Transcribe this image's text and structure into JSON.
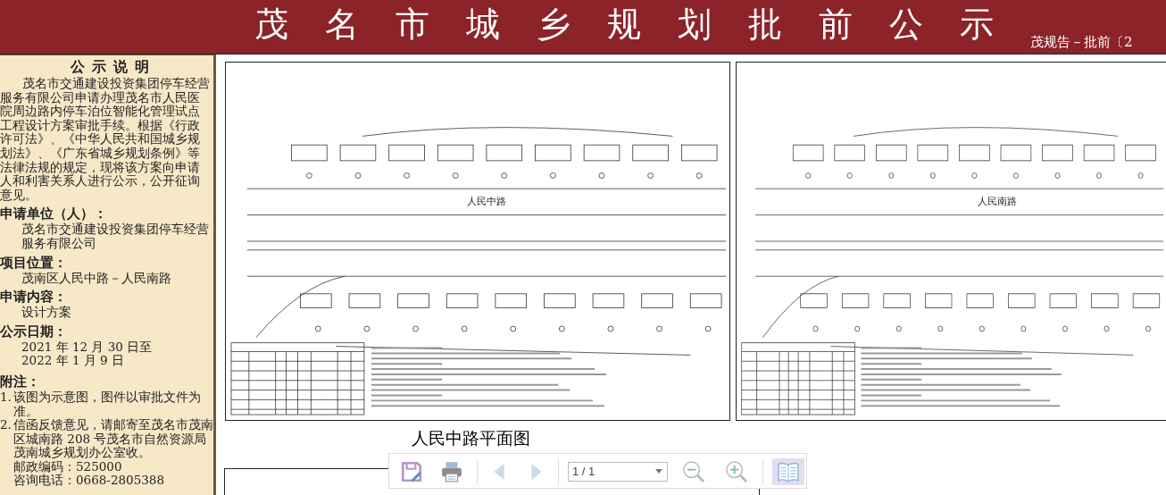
{
  "header": {
    "title": "茂名市城乡规划批前公示",
    "subtitle": "茂规告－批前〔2"
  },
  "notice": {
    "heading": "公示说明",
    "body": "茂名市交通建设投资集团停车经营服务有限公司申请办理茂名市人民医院周边路内停车泊位智能化管理试点工程设计方案审批手续。根据《行政许可法》、《中华人民共和国城乡规划法》、《广东省城乡规划条例》等法律法规的规定，现将该方案向申请人和利害关系人进行公示，公开征询意见。",
    "sections": [
      {
        "label": "申请单位（人）：",
        "lines": [
          "茂名市交通建设投资集团停车经营服务有限公司"
        ]
      },
      {
        "label": "项目位置：",
        "lines": [
          "茂南区人民中路－人民南路"
        ]
      },
      {
        "label": "申请内容：",
        "lines": [
          "设计方案"
        ]
      },
      {
        "label": "公示日期：",
        "lines": [
          "2021 年 12 月 30 日至",
          "2022 年 1 月 9 日"
        ]
      }
    ],
    "notes": {
      "label": "附注：",
      "items": [
        {
          "number": "1.",
          "text": "该图为示意图，图件以审批文件为准。"
        },
        {
          "number": "2.",
          "text": "信函反馈意见，请邮寄至茂名市茂南区城南路 208 号茂名市自然资源局茂南城乡规划办公室收。"
        }
      ],
      "contacts": [
        "邮政编码：525000",
        "咨询电话：0668-2805388"
      ]
    }
  },
  "plans": [
    {
      "road_label": "人民中路"
    },
    {
      "road_label": "人民南路"
    }
  ],
  "caption": "人民中路平面图",
  "toolbar": {
    "buttons": [
      {
        "kind": "save",
        "disabled": false,
        "active": false
      },
      {
        "kind": "print",
        "disabled": false,
        "active": false
      },
      {
        "kind": "prev",
        "disabled": true,
        "active": false
      },
      {
        "kind": "next",
        "disabled": true,
        "active": false
      },
      {
        "kind": "page",
        "value": "1 / 1"
      },
      {
        "kind": "zoom_out",
        "disabled": false,
        "active": false
      },
      {
        "kind": "zoom_in",
        "disabled": false,
        "active": false
      },
      {
        "kind": "book",
        "disabled": false,
        "active": true
      }
    ]
  }
}
